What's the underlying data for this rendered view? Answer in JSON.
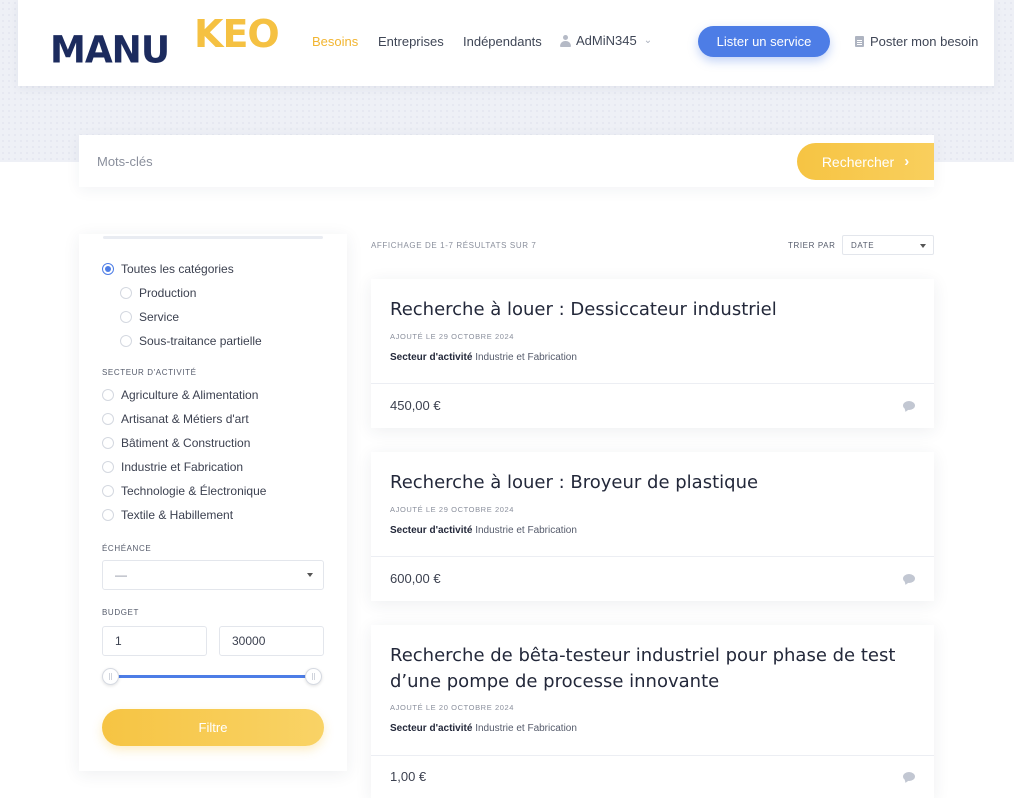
{
  "header": {
    "logo_primary": "MANU",
    "logo_secondary": "KEO",
    "nav": [
      "Besoins",
      "Entreprises",
      "Indépendants"
    ],
    "user": "AdMiN345",
    "list_service": "Lister un service",
    "post_need": "Poster mon besoin"
  },
  "search": {
    "placeholder": "Mots-clés",
    "button": "Rechercher"
  },
  "filters": {
    "categories": [
      "Toutes les catégories",
      "Production",
      "Service",
      "Sous-traitance partielle"
    ],
    "sector_title": "SECTEUR D'ACTIVITÉ",
    "sectors": [
      "Agriculture & Alimentation",
      "Artisanat & Métiers d'art",
      "Bâtiment & Construction",
      "Industrie et Fabrication",
      "Technologie & Électronique",
      "Textile & Habillement"
    ],
    "deadline_title": "ÉCHÉANCE",
    "deadline_value": "—",
    "budget_title": "BUDGET",
    "budget_min": "1",
    "budget_max": "30000",
    "filter_button": "Filtre"
  },
  "results": {
    "count": "AFFICHAGE DE 1-7 RÉSULTATS SUR 7",
    "sort_label": "TRIER PAR",
    "sort_value": "DATE",
    "items": [
      {
        "title": "Recherche à louer : Dessiccateur industriel",
        "date": "AJOUTÉ LE 29 OCTOBRE 2024",
        "sector_label": "Secteur d'activité",
        "sector": "Industrie et Fabrication",
        "price": "450,00 €"
      },
      {
        "title": "Recherche à louer : Broyeur de plastique",
        "date": "AJOUTÉ LE 29 OCTOBRE 2024",
        "sector_label": "Secteur d'activité",
        "sector": "Industrie et Fabrication",
        "price": "600,00 €"
      },
      {
        "title": "Recherche de bêta-testeur industriel pour phase de test d’une pompe de processe innovante",
        "date": "AJOUTÉ LE 20 OCTOBRE 2024",
        "sector_label": "Secteur d'activité",
        "sector": "Industrie et Fabrication",
        "price": "1,00 €"
      }
    ]
  }
}
